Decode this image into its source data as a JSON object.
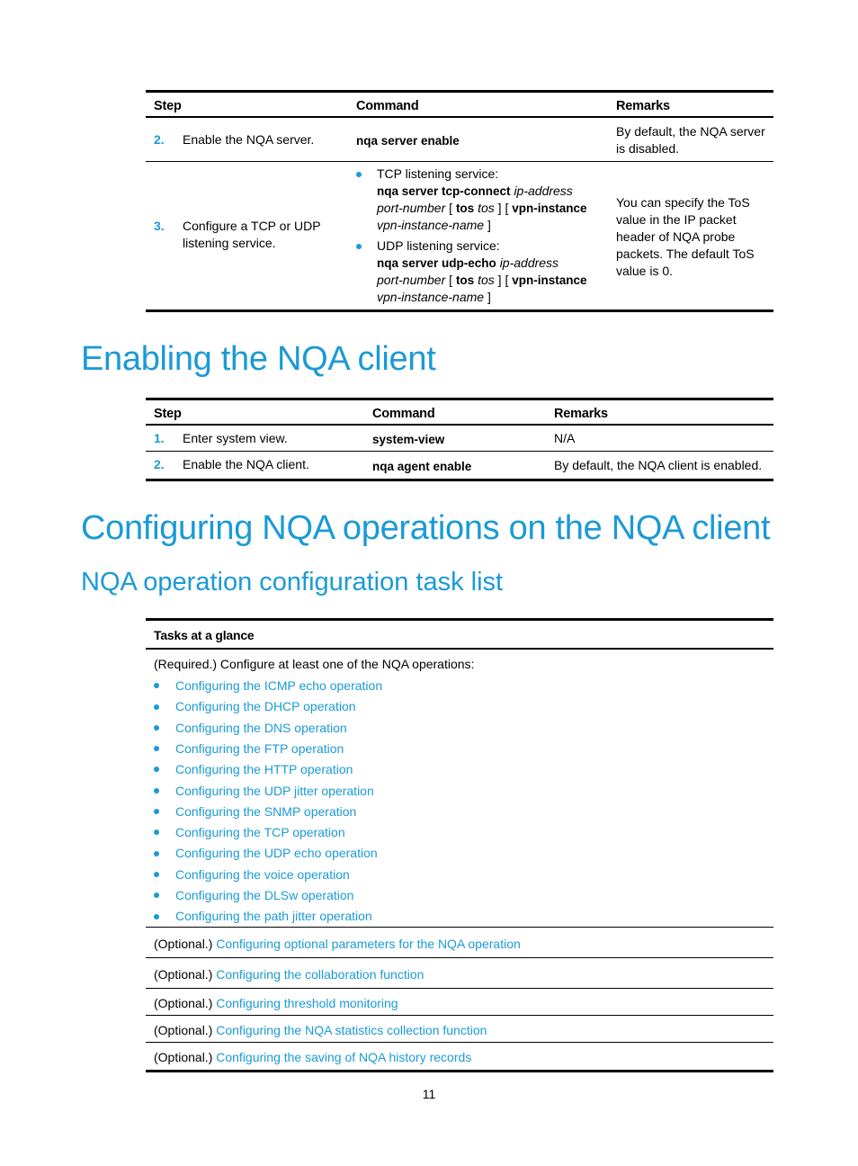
{
  "table1": {
    "headers": [
      "Step",
      "Command",
      "Remarks"
    ],
    "rows": [
      {
        "num": "2.",
        "step": "Enable the NQA server.",
        "command": "nqa server enable",
        "remarks_lines": [
          "By default, the NQA server",
          "is disabled."
        ]
      },
      {
        "num": "3.",
        "step_lines": [
          "Configure a TCP or UDP",
          "listening service."
        ],
        "tcp": {
          "label": "TCP listening service:",
          "cmd": "nqa server tcp-connect",
          "arg1": "ip-address",
          "arg2": "port-number",
          "br_open": "[",
          "tos_kw": "tos",
          "tos_arg": "tos",
          "br_close": "]",
          "vpn_kw": "vpn-instance",
          "vpn_arg": "vpn-instance-name"
        },
        "udp": {
          "label": "UDP listening service:",
          "cmd": "nqa server udp-echo",
          "arg1": "ip-address",
          "arg2": "port-number",
          "br_open": "[",
          "tos_kw": "tos",
          "tos_arg": "tos",
          "br_close": "]",
          "vpn_kw": "vpn-instance",
          "vpn_arg": "vpn-instance-name"
        },
        "remarks_lines": [
          "You can specify the ToS",
          "value in the IP packet",
          "header of NQA probe",
          "packets. The default ToS",
          "value is 0."
        ]
      }
    ]
  },
  "section1": {
    "title": "Enabling the NQA client"
  },
  "table2": {
    "headers": [
      "Step",
      "Command",
      "Remarks"
    ],
    "rows": [
      {
        "num": "1.",
        "step": "Enter system view.",
        "command": "system-view",
        "remarks": "N/A"
      },
      {
        "num": "2.",
        "step": "Enable the NQA client.",
        "command": "nqa agent enable",
        "remarks": "By default, the NQA client is enabled."
      }
    ]
  },
  "section2": {
    "title": "Configuring NQA operations on the NQA client"
  },
  "section3": {
    "title": "NQA operation configuration task list"
  },
  "tasks": {
    "header": "Tasks at a glance",
    "required_intro": "(Required.) Configure at least one of the NQA operations:",
    "required_links": [
      "Configuring the ICMP echo operation",
      "Configuring the DHCP operation",
      "Configuring the DNS operation",
      "Configuring the FTP operation",
      "Configuring the HTTP operation",
      "Configuring the UDP jitter operation",
      "Configuring the SNMP operation",
      "Configuring the TCP operation",
      "Configuring the UDP echo operation",
      "Configuring the voice operation",
      "Configuring the DLSw operation",
      "Configuring the path jitter operation"
    ],
    "optional_prefix": "(Optional.)",
    "optional_links": [
      "Configuring optional parameters for the NQA operation",
      "Configuring the collaboration function",
      "Configuring threshold monitoring",
      "Configuring the NQA statistics collection function",
      "Configuring the saving of NQA history records"
    ]
  },
  "footer": {
    "page_number": "11"
  },
  "colors": {
    "accent": "#1a9ad6",
    "text": "#000000"
  }
}
